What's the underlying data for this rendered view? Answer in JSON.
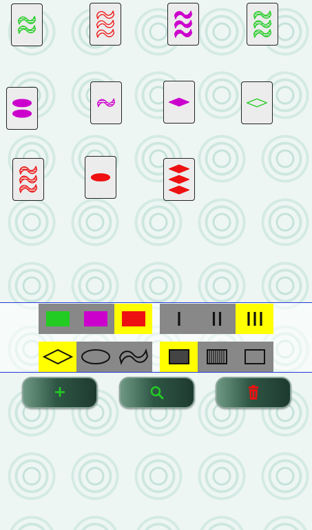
{
  "colors": {
    "green": "#22cc22",
    "red": "#ee1111",
    "purple": "#cc00cc",
    "selected": "#ffff00",
    "segment_bg": "#888888"
  },
  "cards": [
    {
      "id": "c1",
      "count": 2,
      "shape": "squiggle",
      "color": "green",
      "fill": "striped"
    },
    {
      "id": "c2",
      "count": 3,
      "shape": "squiggle",
      "color": "red",
      "fill": "empty"
    },
    {
      "id": "c3",
      "count": 3,
      "shape": "squiggle",
      "color": "purple",
      "fill": "solid"
    },
    {
      "id": "c4",
      "count": 3,
      "shape": "squiggle",
      "color": "green",
      "fill": "striped"
    },
    {
      "id": "c5",
      "count": 2,
      "shape": "oval",
      "color": "purple",
      "fill": "solid"
    },
    {
      "id": "c6",
      "count": 1,
      "shape": "squiggle",
      "color": "purple",
      "fill": "striped"
    },
    {
      "id": "c7",
      "count": 1,
      "shape": "diamond",
      "color": "purple",
      "fill": "solid"
    },
    {
      "id": "c8",
      "count": 1,
      "shape": "diamond",
      "color": "green",
      "fill": "empty"
    },
    {
      "id": "c9",
      "count": 3,
      "shape": "squiggle",
      "color": "red",
      "fill": "striped"
    },
    {
      "id": "c10",
      "count": 1,
      "shape": "oval",
      "color": "red",
      "fill": "solid"
    },
    {
      "id": "c11",
      "count": 3,
      "shape": "diamond",
      "color": "red",
      "fill": "solid"
    }
  ],
  "filters": {
    "color": {
      "options": [
        "green",
        "purple",
        "red"
      ],
      "selected": "red"
    },
    "number": {
      "options": [
        "1",
        "2",
        "3"
      ],
      "selected": "3"
    },
    "shape": {
      "options": [
        "diamond",
        "oval",
        "squiggle"
      ],
      "selected": "diamond"
    },
    "fill": {
      "options": [
        "solid",
        "striped",
        "empty"
      ],
      "selected": "solid"
    }
  },
  "buttons": [
    {
      "name": "add-button",
      "icon": "plus-icon",
      "glyph": "+",
      "color": "#22cc22"
    },
    {
      "name": "search-button",
      "icon": "search-icon",
      "glyph": "",
      "color": "#22cc22"
    },
    {
      "name": "delete-button",
      "icon": "trash-icon",
      "glyph": "",
      "color": "#ee1111"
    }
  ]
}
